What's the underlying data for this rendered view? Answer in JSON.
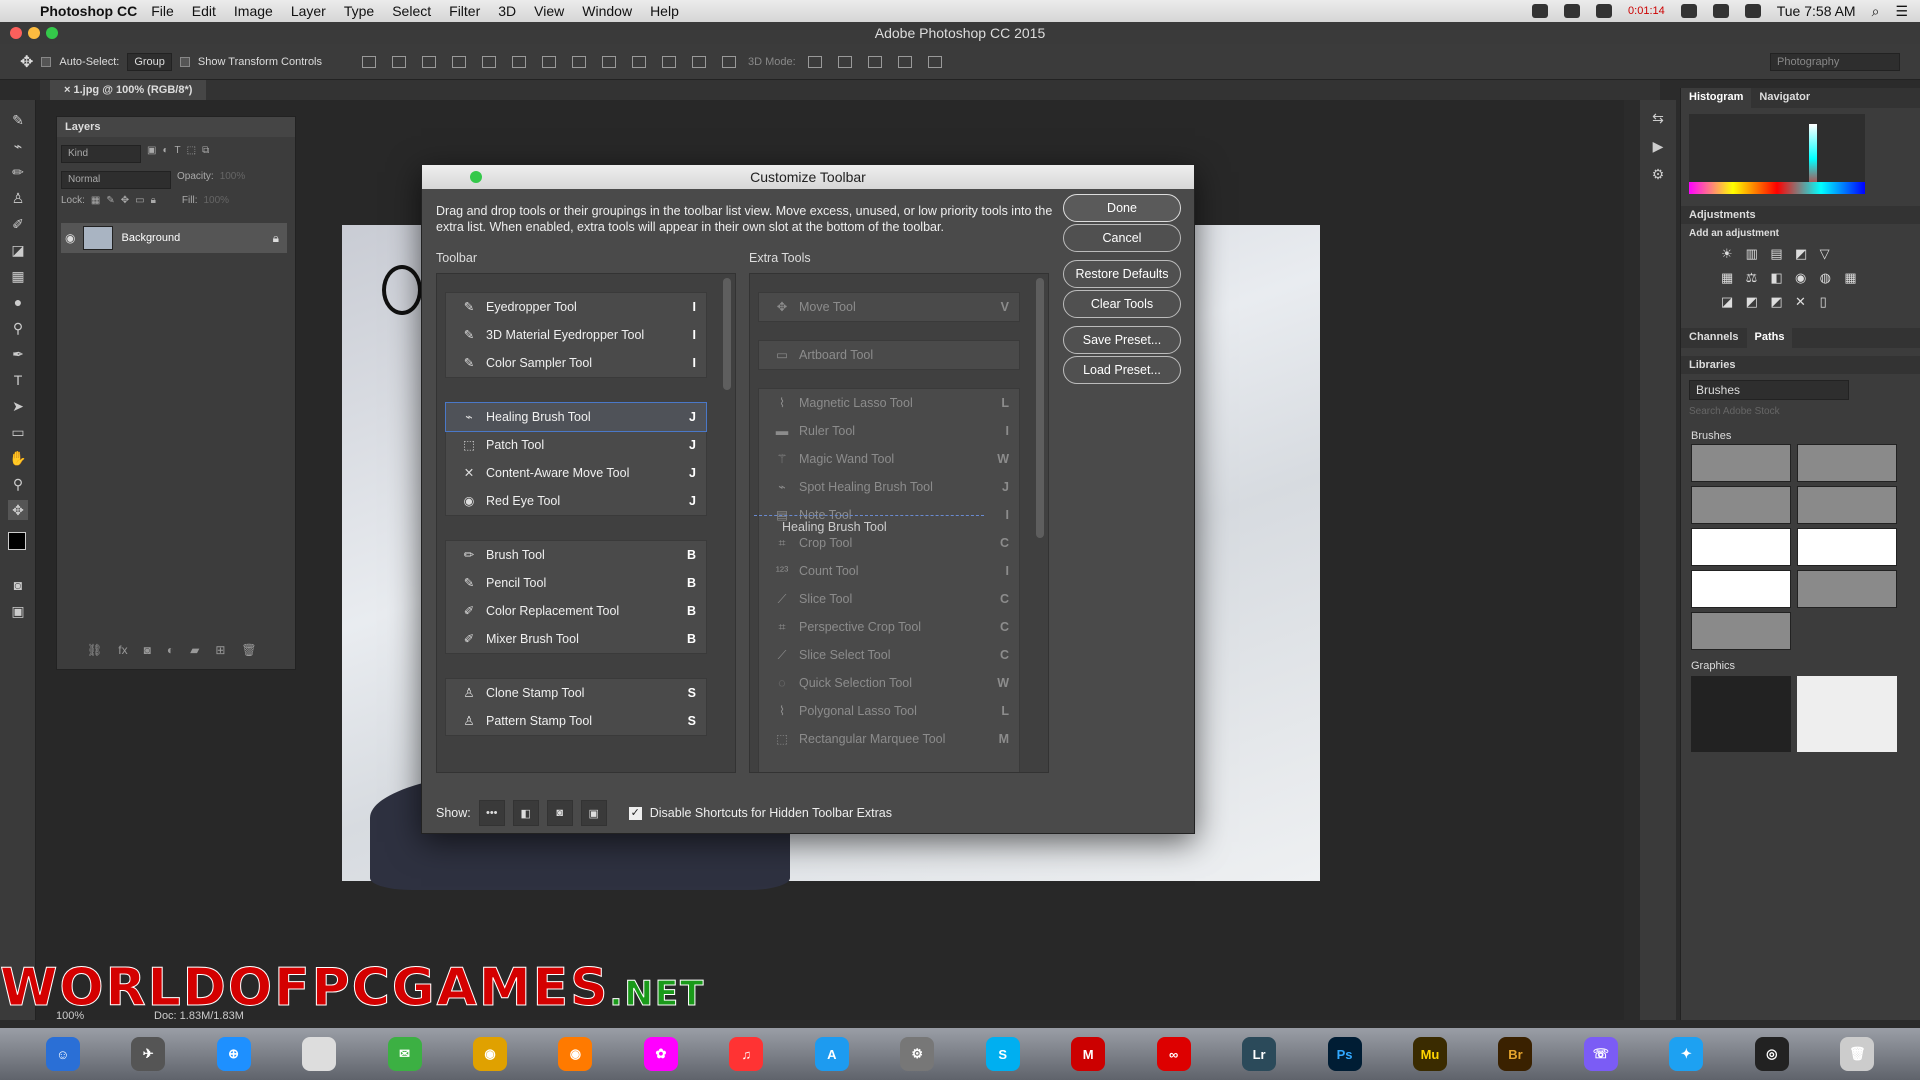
{
  "menubar": {
    "app": "Photoshop CC",
    "items": [
      "File",
      "Edit",
      "Image",
      "Layer",
      "Type",
      "Select",
      "Filter",
      "3D",
      "View",
      "Window",
      "Help"
    ],
    "clock": "Tue 7:58 AM",
    "timer": "0:01:14"
  },
  "window": {
    "title": "Adobe Photoshop CC 2015"
  },
  "options": {
    "auto_select_label": "Auto-Select:",
    "auto_select_value": "Group",
    "transform_label": "Show Transform Controls",
    "mode3d_label": "3D Mode:",
    "workspace": "Photography"
  },
  "document": {
    "tab": "1.jpg @ 100% (RGB/8*)",
    "zoom": "100%",
    "doc_size": "Doc: 1.83M/1.83M"
  },
  "layers": {
    "title": "Layers",
    "kind_placeholder": "Kind",
    "blend_mode": "Normal",
    "opacity_label": "Opacity:",
    "opacity_value": "100%",
    "lock_label": "Lock:",
    "fill_label": "Fill:",
    "fill_value": "100%",
    "layer_name": "Background"
  },
  "right": {
    "tab_histogram": "Histogram",
    "tab_navigator": "Navigator",
    "adjustments": "Adjustments",
    "add_adjustment": "Add an adjustment",
    "tab_channels": "Channels",
    "tab_paths": "Paths",
    "libraries": "Libraries",
    "library_select": "Brushes",
    "search_placeholder": "Search Adobe Stock",
    "brushes_label": "Brushes",
    "graphics_label": "Graphics"
  },
  "dialog": {
    "title": "Customize Toolbar",
    "description": "Drag and drop tools or their groupings in the toolbar list view. Move excess, unused, or low priority tools into the extra list. When enabled, extra tools will appear in their own slot at the bottom of the toolbar.",
    "toolbar_heading": "Toolbar",
    "extra_heading": "Extra Tools",
    "buttons": {
      "done": "Done",
      "cancel": "Cancel",
      "restore": "Restore Defaults",
      "clear": "Clear Tools",
      "save_preset": "Save Preset...",
      "load_preset": "Load Preset..."
    },
    "show_label": "Show:",
    "disable_label": "Disable Shortcuts for Hidden Toolbar Extras",
    "drag_ghost": "Healing Brush Tool",
    "toolbar_groups": [
      [
        {
          "name": "Eyedropper Tool",
          "key": "I"
        },
        {
          "name": "3D Material Eyedropper Tool",
          "key": "I"
        },
        {
          "name": "Color Sampler Tool",
          "key": "I"
        }
      ],
      [
        {
          "name": "Healing Brush Tool",
          "key": "J"
        },
        {
          "name": "Patch Tool",
          "key": "J"
        },
        {
          "name": "Content-Aware Move Tool",
          "key": "J"
        },
        {
          "name": "Red Eye Tool",
          "key": "J"
        }
      ],
      [
        {
          "name": "Brush Tool",
          "key": "B"
        },
        {
          "name": "Pencil Tool",
          "key": "B"
        },
        {
          "name": "Color Replacement Tool",
          "key": "B"
        },
        {
          "name": "Mixer Brush Tool",
          "key": "B"
        }
      ],
      [
        {
          "name": "Clone Stamp Tool",
          "key": "S"
        },
        {
          "name": "Pattern Stamp Tool",
          "key": "S"
        }
      ]
    ],
    "extra_groups": [
      [
        {
          "name": "Move Tool",
          "key": "V"
        }
      ],
      [
        {
          "name": "Artboard Tool",
          "key": ""
        }
      ],
      [
        {
          "name": "Magnetic Lasso Tool",
          "key": "L"
        },
        {
          "name": "Ruler Tool",
          "key": "I"
        },
        {
          "name": "Magic Wand Tool",
          "key": "W"
        },
        {
          "name": "Spot Healing Brush Tool",
          "key": "J"
        },
        {
          "name": "Note Tool",
          "key": "I"
        },
        {
          "name": "Crop Tool",
          "key": "C"
        },
        {
          "name": "Count Tool",
          "key": "I"
        },
        {
          "name": "Slice Tool",
          "key": "C"
        },
        {
          "name": "Perspective Crop Tool",
          "key": "C"
        },
        {
          "name": "Slice Select Tool",
          "key": "C"
        },
        {
          "name": "Quick Selection Tool",
          "key": "W"
        },
        {
          "name": "Polygonal Lasso Tool",
          "key": "L"
        },
        {
          "name": "Rectangular Marquee Tool",
          "key": "M"
        }
      ]
    ]
  },
  "watermark": {
    "main": "WORLDOFPCGAMES",
    "suffix": ".NET"
  },
  "dock": {
    "labels": [
      "Lr",
      "Ps",
      "Mu",
      "Br"
    ]
  }
}
